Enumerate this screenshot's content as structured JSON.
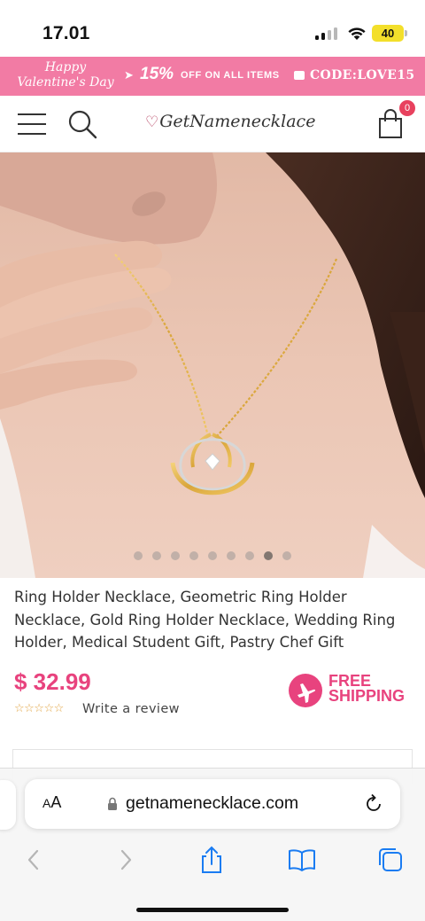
{
  "status_bar": {
    "time": "17.01",
    "battery": "40"
  },
  "promo": {
    "script_line1": "Happy",
    "script_line2": "Valentine's Day",
    "arrow": "➤",
    "percent": "15%",
    "off_text": "OFF ON ALL ITEMS",
    "code_text": "CODE:LOVE15"
  },
  "header": {
    "logo_text": "GetNamenecklace",
    "cart_count": "0"
  },
  "carousel": {
    "count": 9,
    "active_index": 7
  },
  "product": {
    "title": "Ring Holder Necklace, Geometric Ring Holder Necklace, Gold Ring Holder Necklace, Wedding Ring Holder, Medical Student Gift, Pastry Chef Gift",
    "price": "$ 32.99",
    "stars": "☆☆☆☆☆",
    "review_link": "Write a review",
    "free_shipping_line1": "FREE",
    "free_shipping_line2": "SHIPPING"
  },
  "browser": {
    "aa_big": "A",
    "aa_small": "A",
    "url": "getnamenecklace.com"
  },
  "colors": {
    "brand_pink": "#e8437e",
    "banner_pink": "#f27ba4",
    "badge_red": "#e8415e"
  }
}
